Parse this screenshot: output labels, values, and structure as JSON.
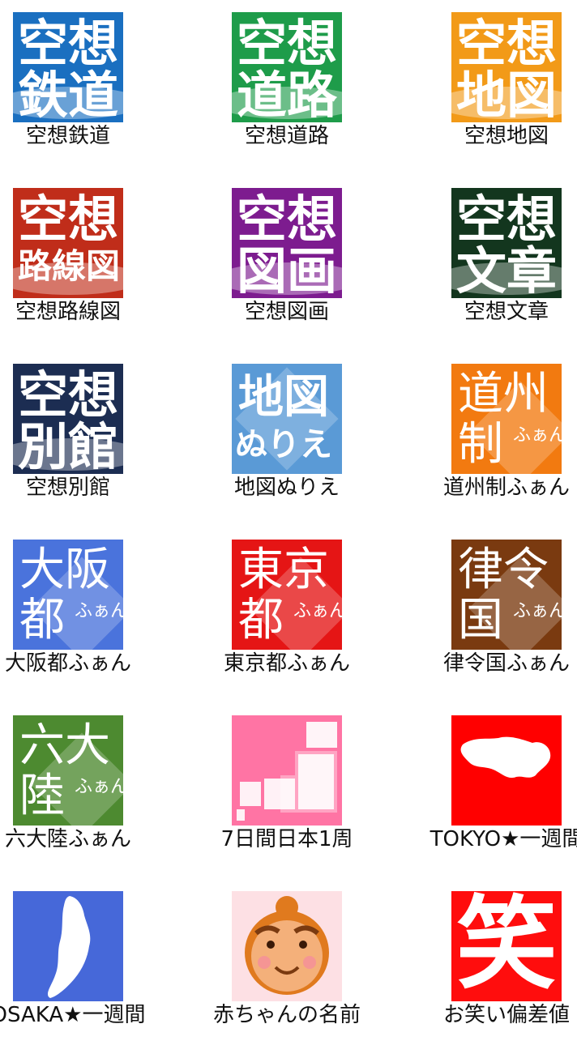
{
  "apps": [
    {
      "label": "空想鉄道",
      "bg": "#1a6fc0",
      "lines": [
        "空想",
        "鉄道"
      ],
      "style": "kuso"
    },
    {
      "label": "空想道路",
      "bg": "#1e9c4a",
      "lines": [
        "空想",
        "道路"
      ],
      "style": "kuso"
    },
    {
      "label": "空想地図",
      "bg": "#f29a18",
      "lines": [
        "空想",
        "地図"
      ],
      "style": "kuso"
    },
    {
      "label": "空想路線図",
      "bg": "#c02d1a",
      "lines": [
        "空想",
        "路線図"
      ],
      "style": "kuso"
    },
    {
      "label": "空想図画",
      "bg": "#7d1c8f",
      "lines": [
        "空想",
        "図画"
      ],
      "style": "kuso"
    },
    {
      "label": "空想文章",
      "bg": "#13361e",
      "lines": [
        "空想",
        "文章"
      ],
      "style": "kuso"
    },
    {
      "label": "空想別館",
      "bg": "#1c2d52",
      "lines": [
        "空想",
        "別館"
      ],
      "style": "kuso"
    },
    {
      "label": "地図ぬりえ",
      "bg": "#5a9ad6",
      "lines": [
        "地図",
        "ぬりえ"
      ],
      "style": "nurie"
    },
    {
      "label": "道州制ふぁん",
      "bg": "#f27a10",
      "lines": [
        "道州",
        "制"
      ],
      "small": "ふぁん",
      "style": "fan"
    },
    {
      "label": "大阪都ふぁん",
      "bg": "#4a73dc",
      "lines": [
        "大阪",
        "都"
      ],
      "small": "ふぁん",
      "style": "fan"
    },
    {
      "label": "東京都ふぁん",
      "bg": "#e51515",
      "lines": [
        "東京",
        "都"
      ],
      "small": "ふぁん",
      "style": "fan"
    },
    {
      "label": "律令国ふぁん",
      "bg": "#7a3a10",
      "lines": [
        "律令",
        "国"
      ],
      "small": "ふぁん",
      "style": "fan"
    },
    {
      "label": "六大陸ふぁん",
      "bg": "#4d8a30",
      "lines": [
        "六大",
        "陸"
      ],
      "small": "ふぁん",
      "style": "fan"
    },
    {
      "label": "7日間日本1周",
      "bg": "#ff74a4",
      "style": "japan"
    },
    {
      "label": "TOKYO★一週間",
      "bg": "#ff0000",
      "style": "tokyo"
    },
    {
      "label": "OSAKA★一週間",
      "bg": "#4668d9",
      "style": "osaka"
    },
    {
      "label": "赤ちゃんの名前",
      "bg": "#fde0e4",
      "style": "baby"
    },
    {
      "label": "お笑い偏差値",
      "bg": "#ff0d0d",
      "lines": [
        "笑"
      ],
      "style": "warai"
    }
  ]
}
